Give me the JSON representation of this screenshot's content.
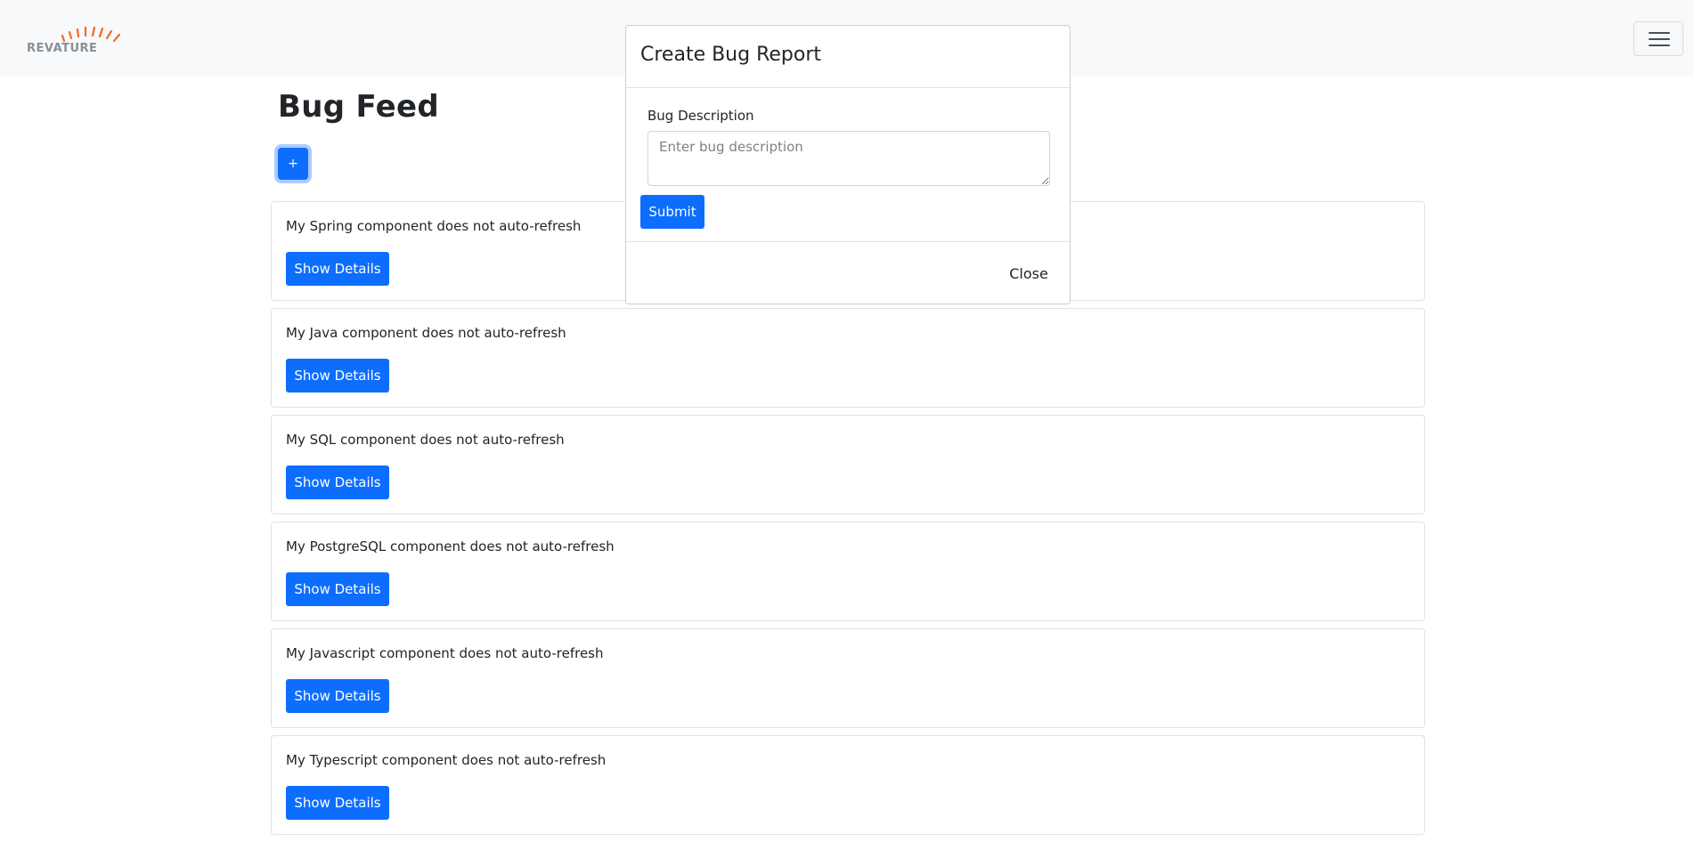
{
  "header": {
    "logo_text": "REVATURE",
    "logo_accent_color": "#f26925",
    "menu_icon": "hamburger-menu-icon"
  },
  "main": {
    "title": "Bug Feed",
    "add_label": "+",
    "bugs": [
      {
        "description": "My Spring component does not auto-refresh",
        "button_label": "Show Details"
      },
      {
        "description": "My Java component does not auto-refresh",
        "button_label": "Show Details"
      },
      {
        "description": "My SQL component does not auto-refresh",
        "button_label": "Show Details"
      },
      {
        "description": "My PostgreSQL component does not auto-refresh",
        "button_label": "Show Details"
      },
      {
        "description": "My Javascript component does not auto-refresh",
        "button_label": "Show Details"
      },
      {
        "description": "My Typescript component does not auto-refresh",
        "button_label": "Show Details"
      }
    ]
  },
  "modal": {
    "title": "Create Bug Report",
    "field_label": "Bug Description",
    "field_placeholder": "Enter bug description",
    "field_value": "",
    "submit_label": "Submit",
    "close_label": "Close"
  },
  "colors": {
    "primary": "#0d6efd",
    "navbar_bg": "#f8f9fa"
  }
}
